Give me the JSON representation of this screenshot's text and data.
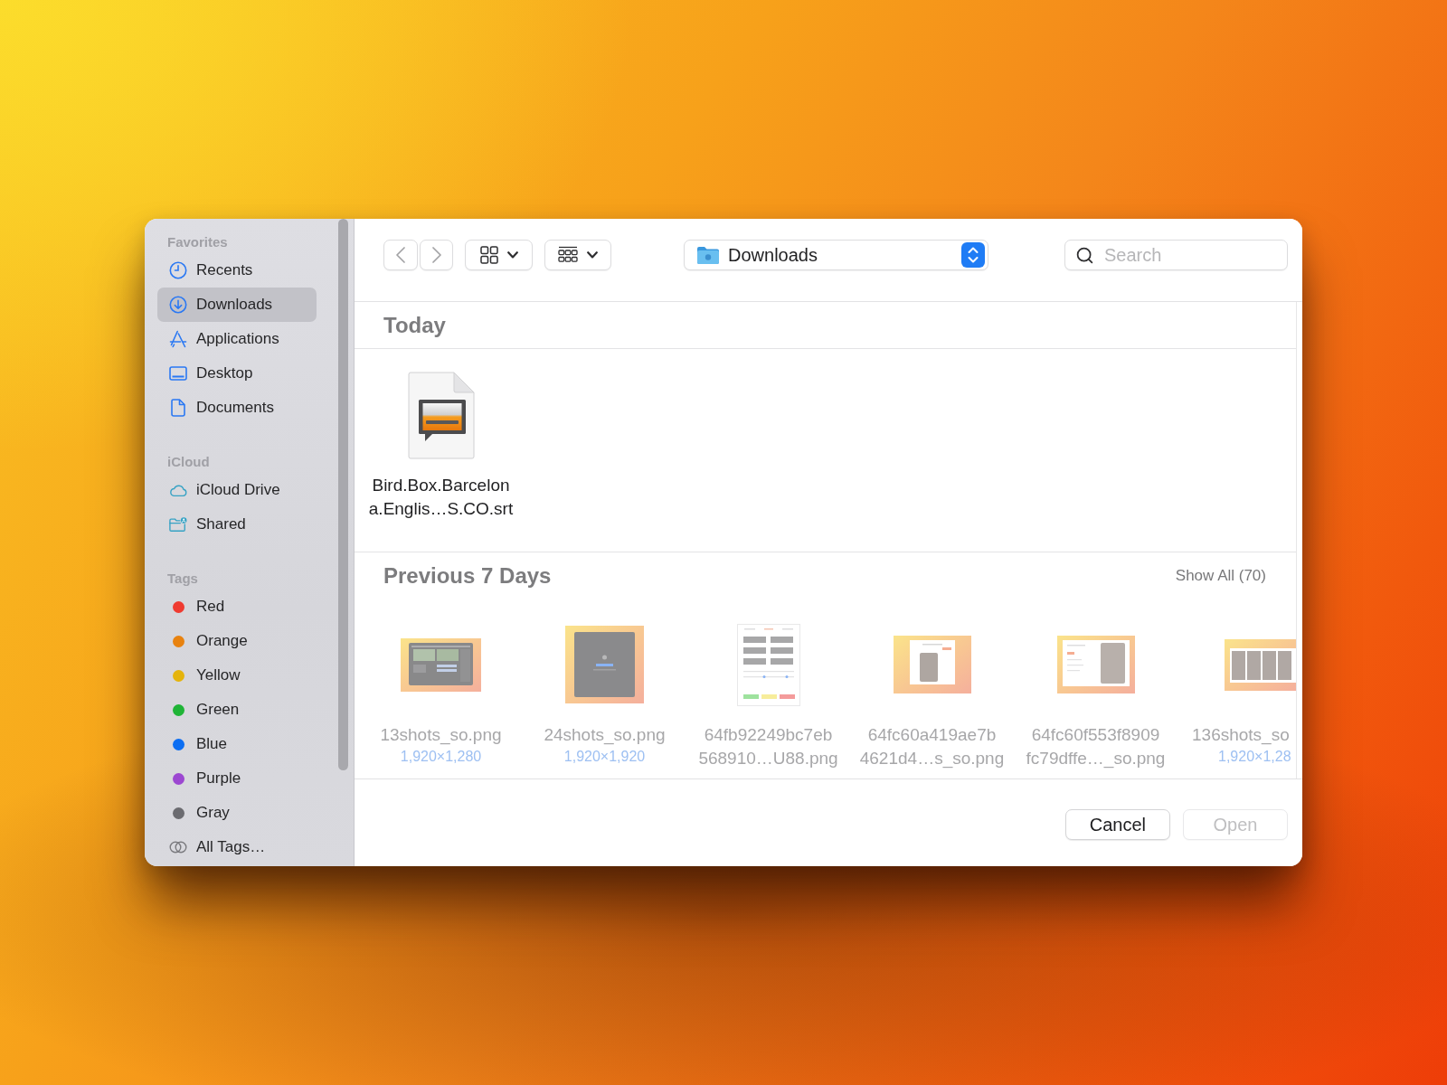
{
  "sidebar": {
    "sections": [
      {
        "title": "Favorites",
        "items": [
          {
            "label": "Recents",
            "kind": "clock",
            "selected": false
          },
          {
            "label": "Downloads",
            "kind": "download",
            "selected": true
          },
          {
            "label": "Applications",
            "kind": "apps",
            "selected": false
          },
          {
            "label": "Desktop",
            "kind": "desktop",
            "selected": false
          },
          {
            "label": "Documents",
            "kind": "document",
            "selected": false
          }
        ]
      },
      {
        "title": "iCloud",
        "items": [
          {
            "label": "iCloud Drive",
            "kind": "cloud",
            "selected": false
          },
          {
            "label": "Shared",
            "kind": "shared",
            "selected": false
          }
        ]
      },
      {
        "title": "Tags",
        "items": [
          {
            "label": "Red",
            "kind": "tag",
            "color": "#ef3a30",
            "selected": false
          },
          {
            "label": "Orange",
            "kind": "tag",
            "color": "#e8820f",
            "selected": false
          },
          {
            "label": "Yellow",
            "kind": "tag",
            "color": "#e5b40c",
            "selected": false
          },
          {
            "label": "Green",
            "kind": "tag",
            "color": "#1fb436",
            "selected": false
          },
          {
            "label": "Blue",
            "kind": "tag",
            "color": "#0c6ef2",
            "selected": false
          },
          {
            "label": "Purple",
            "kind": "tag",
            "color": "#9c47d1",
            "selected": false
          },
          {
            "label": "Gray",
            "kind": "tag",
            "color": "#6b6b70",
            "selected": false
          },
          {
            "label": "All Tags…",
            "kind": "alltags",
            "selected": false
          }
        ]
      }
    ]
  },
  "toolbar": {
    "location": "Downloads",
    "search": {
      "placeholder": "Search"
    }
  },
  "sections": [
    {
      "title": "Today",
      "files": [
        {
          "name": "Bird.Box.Barcelon\na.Englis…S.CO.srt",
          "kind": "subtitle",
          "disabled": false
        }
      ]
    },
    {
      "title": "Previous 7 Days",
      "action": "Show All (70)",
      "files": [
        {
          "name": "13shots_so.png",
          "dims": "1,920×1,280",
          "kind": "editor",
          "disabled": true
        },
        {
          "name": "24shots_so.png",
          "dims": "1,920×1,920",
          "kind": "dialog",
          "disabled": true
        },
        {
          "name": "64fb92249bc7eb\n568910…U88.png",
          "kind": "form",
          "disabled": true
        },
        {
          "name": "64fc60a419ae7b\n4621d4…s_so.png",
          "kind": "profile",
          "disabled": true
        },
        {
          "name": "64fc60f553f8909\nfc79dffe…_so.png",
          "kind": "settings",
          "disabled": true
        },
        {
          "name": "136shots_so",
          "dims": "1,920×1,28",
          "kind": "gallery",
          "disabled": true
        }
      ]
    }
  ],
  "buttons": [
    {
      "label": "Cancel",
      "disabled": false
    },
    {
      "label": "Open",
      "disabled": true
    }
  ]
}
